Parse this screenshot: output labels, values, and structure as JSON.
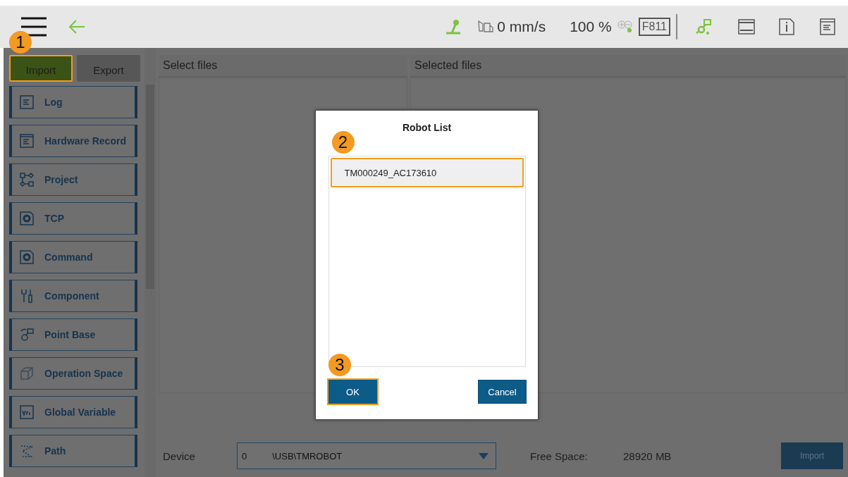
{
  "top_bar": {
    "speed": "0 mm/s",
    "percent": "100 %",
    "code": "F811"
  },
  "tabs": [
    {
      "label": "Import",
      "selected": true,
      "callout": "1"
    },
    {
      "label": "Export",
      "selected": false
    }
  ],
  "sidebar": {
    "items": [
      {
        "label": "Log"
      },
      {
        "label": "Hardware Record"
      },
      {
        "label": "Project"
      },
      {
        "label": "TCP"
      },
      {
        "label": "Command"
      },
      {
        "label": "Component"
      },
      {
        "label": "Point Base"
      },
      {
        "label": "Operation Space"
      },
      {
        "label": "Global Variable"
      },
      {
        "label": "Path"
      }
    ]
  },
  "panels": [
    {
      "title": "Select files"
    },
    {
      "title": "Selected files"
    }
  ],
  "bottom": {
    "device_label": "Device",
    "device_index": "0",
    "device_path": "\\USB\\TMROBOT",
    "free_space_label": "Free Space:",
    "free_space": "28920 MB",
    "import_button": "Import"
  },
  "dialog": {
    "title": "Robot List",
    "items": [
      {
        "label": "TM000249_AC173610",
        "selected": true,
        "callout": "2"
      }
    ],
    "buttons": [
      {
        "label": "OK",
        "callout": "3"
      },
      {
        "label": "Cancel"
      }
    ]
  }
}
